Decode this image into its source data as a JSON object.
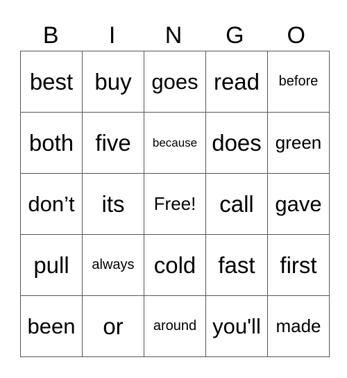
{
  "header": [
    "B",
    "I",
    "N",
    "G",
    "O"
  ],
  "rows": [
    [
      {
        "text": "best",
        "size": "s-xl"
      },
      {
        "text": "buy",
        "size": "s-xl"
      },
      {
        "text": "goes",
        "size": "s-l"
      },
      {
        "text": "read",
        "size": "s-xl"
      },
      {
        "text": "before",
        "size": "s-xs"
      }
    ],
    [
      {
        "text": "both",
        "size": "s-xl"
      },
      {
        "text": "five",
        "size": "s-xl"
      },
      {
        "text": "because",
        "size": "s-xxs"
      },
      {
        "text": "does",
        "size": "s-xl"
      },
      {
        "text": "green",
        "size": "s-m"
      }
    ],
    [
      {
        "text": "don’t",
        "size": "s-l"
      },
      {
        "text": "its",
        "size": "s-xl"
      },
      {
        "text": "Free!",
        "size": "s-m"
      },
      {
        "text": "call",
        "size": "s-xl"
      },
      {
        "text": "gave",
        "size": "s-l"
      }
    ],
    [
      {
        "text": "pull",
        "size": "s-xl"
      },
      {
        "text": "always",
        "size": "s-xs"
      },
      {
        "text": "cold",
        "size": "s-xl"
      },
      {
        "text": "fast",
        "size": "s-xl"
      },
      {
        "text": "first",
        "size": "s-xl"
      }
    ],
    [
      {
        "text": "been",
        "size": "s-l"
      },
      {
        "text": "or",
        "size": "s-xl"
      },
      {
        "text": "around",
        "size": "s-xs"
      },
      {
        "text": "you'll",
        "size": "s-l"
      },
      {
        "text": "made",
        "size": "s-m"
      }
    ]
  ]
}
